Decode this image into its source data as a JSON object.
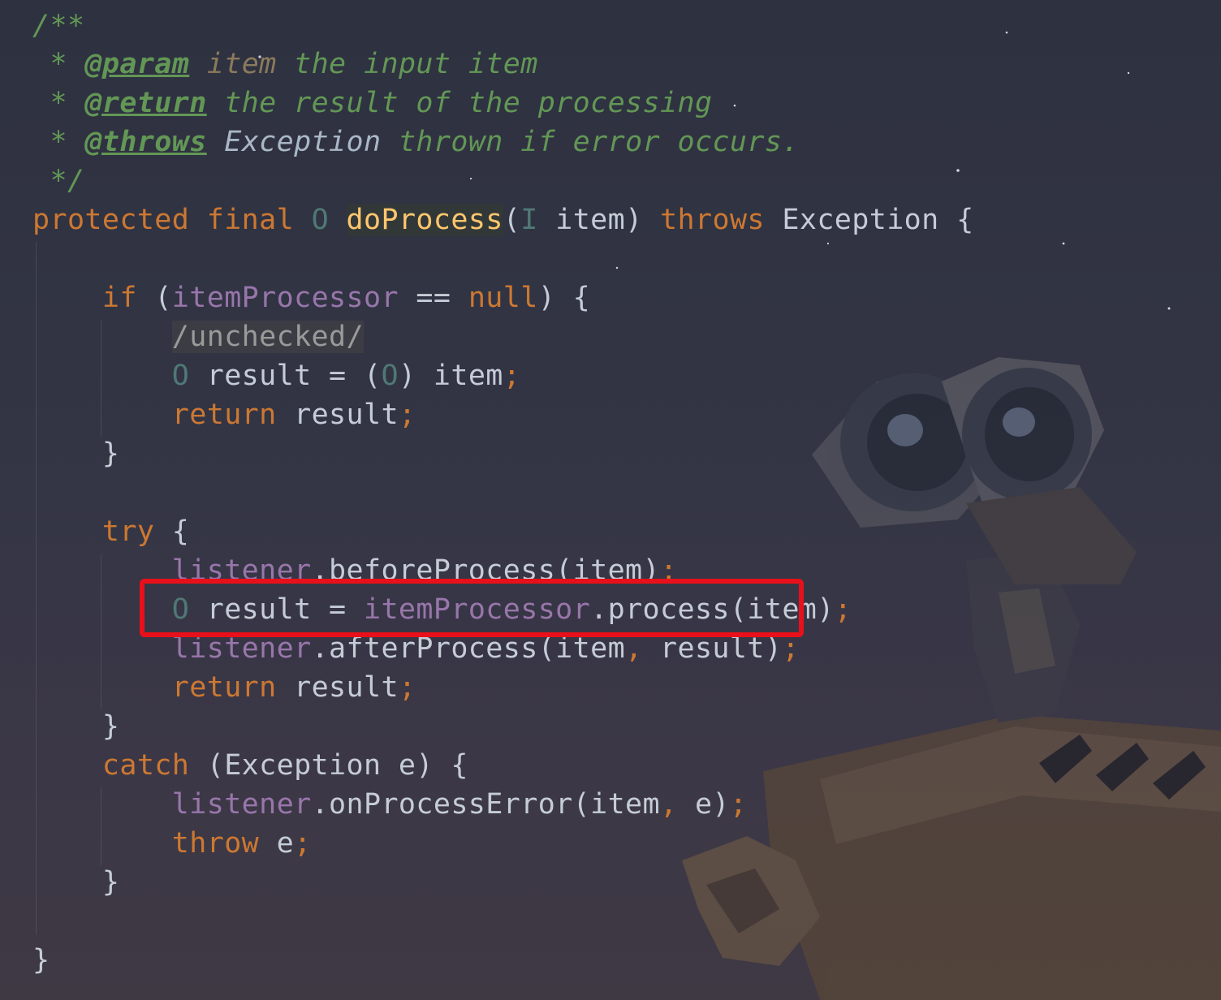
{
  "editor": {
    "lines": [
      {
        "tokens": [
          {
            "t": "/**",
            "c": "comment"
          }
        ]
      },
      {
        "tokens": [
          {
            "t": " * ",
            "c": "comment"
          },
          {
            "t": "@param",
            "c": "doc-tag"
          },
          {
            "t": " ",
            "c": "comment"
          },
          {
            "t": "item",
            "c": "doc-param"
          },
          {
            "t": " the input item",
            "c": "comment"
          }
        ]
      },
      {
        "tokens": [
          {
            "t": " * ",
            "c": "comment"
          },
          {
            "t": "@return",
            "c": "doc-tag"
          },
          {
            "t": " the result of the processing",
            "c": "comment"
          }
        ]
      },
      {
        "tokens": [
          {
            "t": " * ",
            "c": "comment"
          },
          {
            "t": "@throws",
            "c": "doc-tag"
          },
          {
            "t": " ",
            "c": "comment"
          },
          {
            "t": "Exception",
            "c": "doc-ref"
          },
          {
            "t": " thrown if error occurs.",
            "c": "comment"
          }
        ]
      },
      {
        "tokens": [
          {
            "t": " */",
            "c": "comment"
          }
        ]
      },
      {
        "tokens": [
          {
            "t": "protected final ",
            "c": "kw"
          },
          {
            "t": "O",
            "c": "type"
          },
          {
            "t": " ",
            "c": "plain"
          },
          {
            "t": "doProcess",
            "c": "method-decl"
          },
          {
            "t": "(",
            "c": "plain"
          },
          {
            "t": "I",
            "c": "type"
          },
          {
            "t": " item) ",
            "c": "plain"
          },
          {
            "t": "throws ",
            "c": "kw"
          },
          {
            "t": "Exception {",
            "c": "plain"
          }
        ]
      },
      {
        "tokens": []
      },
      {
        "tokens": [
          {
            "t": "    ",
            "c": "plain"
          },
          {
            "t": "if",
            "c": "kw"
          },
          {
            "t": " (",
            "c": "plain"
          },
          {
            "t": "itemProcessor",
            "c": "field"
          },
          {
            "t": " == ",
            "c": "plain"
          },
          {
            "t": "null",
            "c": "kw"
          },
          {
            "t": ") {",
            "c": "plain"
          }
        ]
      },
      {
        "tokens": [
          {
            "t": "        ",
            "c": "plain"
          },
          {
            "t": "/unchecked/",
            "c": "suppress"
          }
        ]
      },
      {
        "tokens": [
          {
            "t": "        ",
            "c": "plain"
          },
          {
            "t": "O",
            "c": "type"
          },
          {
            "t": " result = (",
            "c": "plain"
          },
          {
            "t": "O",
            "c": "type"
          },
          {
            "t": ") item",
            "c": "plain"
          },
          {
            "t": ";",
            "c": "semi"
          }
        ]
      },
      {
        "tokens": [
          {
            "t": "        ",
            "c": "plain"
          },
          {
            "t": "return",
            "c": "kw"
          },
          {
            "t": " result",
            "c": "plain"
          },
          {
            "t": ";",
            "c": "semi"
          }
        ]
      },
      {
        "tokens": [
          {
            "t": "    }",
            "c": "plain"
          }
        ]
      },
      {
        "tokens": []
      },
      {
        "tokens": [
          {
            "t": "    ",
            "c": "plain"
          },
          {
            "t": "try",
            "c": "kw"
          },
          {
            "t": " {",
            "c": "plain"
          }
        ]
      },
      {
        "tokens": [
          {
            "t": "        ",
            "c": "plain"
          },
          {
            "t": "listener",
            "c": "field"
          },
          {
            "t": ".beforeProcess(item)",
            "c": "plain"
          },
          {
            "t": ";",
            "c": "semi"
          }
        ]
      },
      {
        "tokens": [
          {
            "t": "        ",
            "c": "plain"
          },
          {
            "t": "O",
            "c": "type"
          },
          {
            "t": " result = ",
            "c": "plain"
          },
          {
            "t": "itemProcessor",
            "c": "field"
          },
          {
            "t": ".process(item)",
            "c": "plain"
          },
          {
            "t": ";",
            "c": "semi"
          }
        ]
      },
      {
        "tokens": [
          {
            "t": "        ",
            "c": "plain"
          },
          {
            "t": "listener",
            "c": "field"
          },
          {
            "t": ".afterProcess(item",
            "c": "plain"
          },
          {
            "t": ",",
            "c": "semi"
          },
          {
            "t": " result)",
            "c": "plain"
          },
          {
            "t": ";",
            "c": "semi"
          }
        ]
      },
      {
        "tokens": [
          {
            "t": "        ",
            "c": "plain"
          },
          {
            "t": "return",
            "c": "kw"
          },
          {
            "t": " result",
            "c": "plain"
          },
          {
            "t": ";",
            "c": "semi"
          }
        ]
      },
      {
        "tokens": [
          {
            "t": "    }",
            "c": "plain"
          }
        ]
      },
      {
        "tokens": [
          {
            "t": "    ",
            "c": "plain"
          },
          {
            "t": "catch",
            "c": "kw"
          },
          {
            "t": " (Exception e) {",
            "c": "plain"
          }
        ]
      },
      {
        "tokens": [
          {
            "t": "        ",
            "c": "plain"
          },
          {
            "t": "listener",
            "c": "field"
          },
          {
            "t": ".onProcessError(item",
            "c": "plain"
          },
          {
            "t": ",",
            "c": "semi"
          },
          {
            "t": " e)",
            "c": "plain"
          },
          {
            "t": ";",
            "c": "semi"
          }
        ]
      },
      {
        "tokens": [
          {
            "t": "        ",
            "c": "plain"
          },
          {
            "t": "throw",
            "c": "kw"
          },
          {
            "t": " e",
            "c": "plain"
          },
          {
            "t": ";",
            "c": "semi"
          }
        ]
      },
      {
        "tokens": [
          {
            "t": "    }",
            "c": "plain"
          }
        ]
      },
      {
        "tokens": []
      },
      {
        "tokens": [
          {
            "t": "}",
            "c": "plain"
          }
        ]
      }
    ],
    "highlighted_line": 15,
    "highlight_color": "#e8101a",
    "background_image": "wall-e-robot-illustration"
  }
}
